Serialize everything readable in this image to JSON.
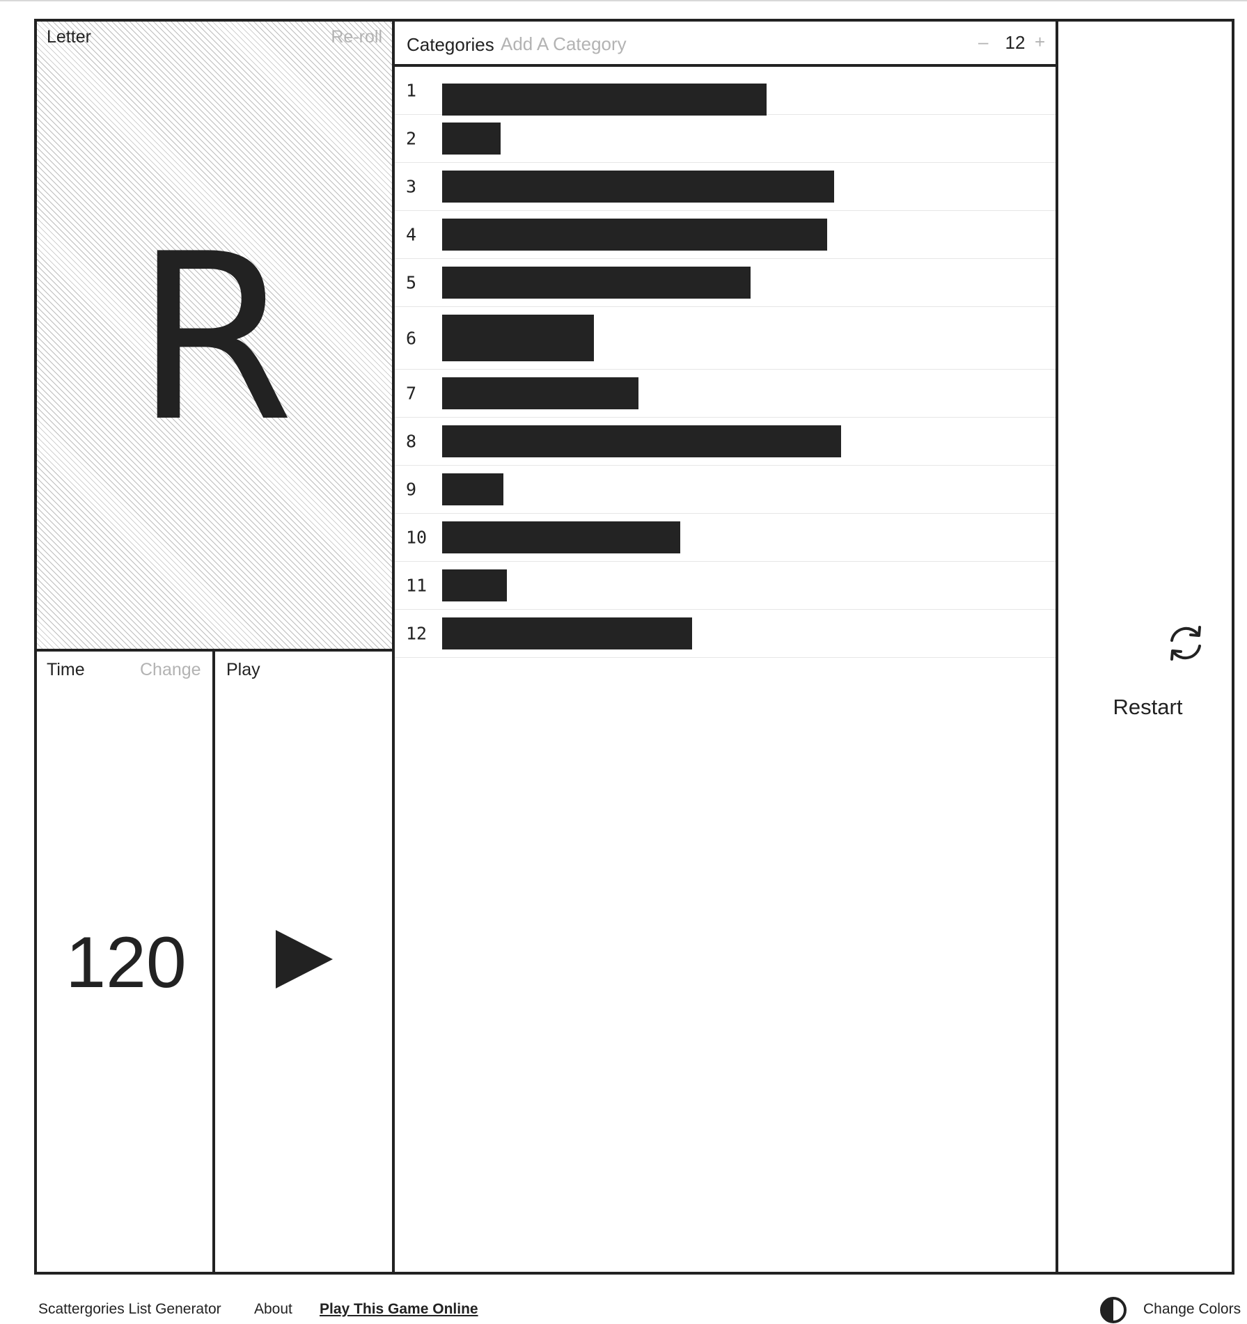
{
  "letter_panel": {
    "label": "Letter",
    "reroll_label": "Re-roll",
    "current_letter": "R"
  },
  "time_panel": {
    "label": "Time",
    "change_label": "Change",
    "seconds": "120"
  },
  "play_panel": {
    "label": "Play",
    "play_icon": "play-icon"
  },
  "categories_panel": {
    "label": "Categories",
    "add_placeholder": "Add A Category",
    "add_value": "",
    "stepper": {
      "minus": "–",
      "count": "12",
      "plus": "+"
    },
    "items": [
      {
        "num": "1",
        "hidden_fraction": 0.53
      },
      {
        "num": "2",
        "hidden_fraction": 0.095
      },
      {
        "num": "3",
        "hidden_fraction": 0.64
      },
      {
        "num": "4",
        "hidden_fraction": 0.628
      },
      {
        "num": "5",
        "hidden_fraction": 0.503
      },
      {
        "num": "6",
        "hidden_fraction": 0.248
      },
      {
        "num": "7",
        "hidden_fraction": 0.321
      },
      {
        "num": "8",
        "hidden_fraction": 0.651
      },
      {
        "num": "9",
        "hidden_fraction": 0.1
      },
      {
        "num": "10",
        "hidden_fraction": 0.389
      },
      {
        "num": "11",
        "hidden_fraction": 0.106
      },
      {
        "num": "12",
        "hidden_fraction": 0.408
      }
    ]
  },
  "restart": {
    "label": "Restart",
    "icon": "refresh-icon"
  },
  "footer": {
    "title": "Scattergories List Generator",
    "about": "About",
    "play_online": "Play This Game Online",
    "change_colors": "Change Colors",
    "colors_icon": "contrast-icon"
  },
  "colors": {
    "ink": "#222222",
    "muted": "#b3b3b3",
    "background": "#ffffff",
    "hatch": "#bdbdbd"
  }
}
